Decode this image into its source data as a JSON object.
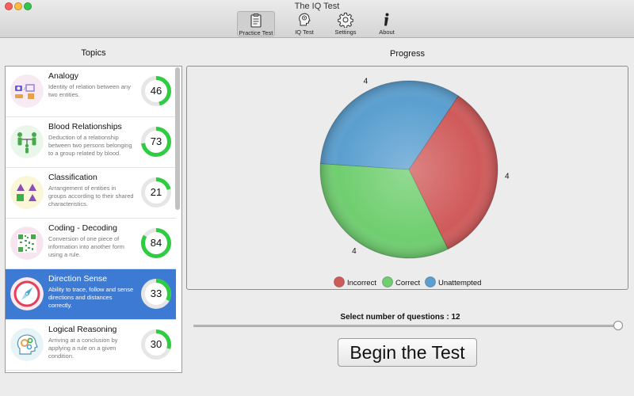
{
  "window": {
    "title": "The IQ Test"
  },
  "toolbar": {
    "items": [
      {
        "label": "Practice Test",
        "icon": "clipboard-icon",
        "active": true
      },
      {
        "label": "IQ Test",
        "icon": "brain-head-icon",
        "active": false
      },
      {
        "label": "Settings",
        "icon": "gear-icon",
        "active": false
      },
      {
        "label": "About",
        "icon": "info-icon",
        "active": false
      }
    ]
  },
  "topics": {
    "heading": "Topics",
    "items": [
      {
        "name": "Analogy",
        "description": "Identity of relation between any two entities.",
        "score": 46,
        "icon": "analogy-icon",
        "selected": false
      },
      {
        "name": "Blood Relationships",
        "description": "Deduction of a relationship between two persons belonging to a group related by blood.",
        "score": 73,
        "icon": "family-icon",
        "selected": false
      },
      {
        "name": "Classification",
        "description": "Arrangement of entities in groups according to their shared characteristics.",
        "score": 21,
        "icon": "shapes-icon",
        "selected": false
      },
      {
        "name": "Coding - Decoding",
        "description": "Conversion of one piece of information into another form using a rule.",
        "score": 84,
        "icon": "qr-code-icon",
        "selected": false
      },
      {
        "name": "Direction Sense",
        "description": "Ability to trace, follow and sense directions and distances correctly.",
        "score": 33,
        "icon": "compass-icon",
        "selected": true
      },
      {
        "name": "Logical Reasoning",
        "description": "Arriving at a conclusion by applying a rule on a given condition.",
        "score": 30,
        "icon": "gears-head-icon",
        "selected": false
      }
    ]
  },
  "progress": {
    "heading": "Progress",
    "chart_data": {
      "type": "pie",
      "slices": [
        {
          "name": "Incorrect",
          "value": 4,
          "color": "#d05a5a"
        },
        {
          "name": "Correct",
          "value": 4,
          "color": "#6fce6f"
        },
        {
          "name": "Unattempted",
          "value": 4,
          "color": "#5a9fd0"
        }
      ],
      "legend_position": "bottom"
    }
  },
  "slider": {
    "label": "Select number of questions : 12",
    "value_fraction": 1.0
  },
  "begin_button": {
    "label": "Begin the Test"
  },
  "colors": {
    "selected_row": "#3d7ad4",
    "ring_progress": "#2ecc40",
    "ring_track": "#e6e6e6"
  }
}
